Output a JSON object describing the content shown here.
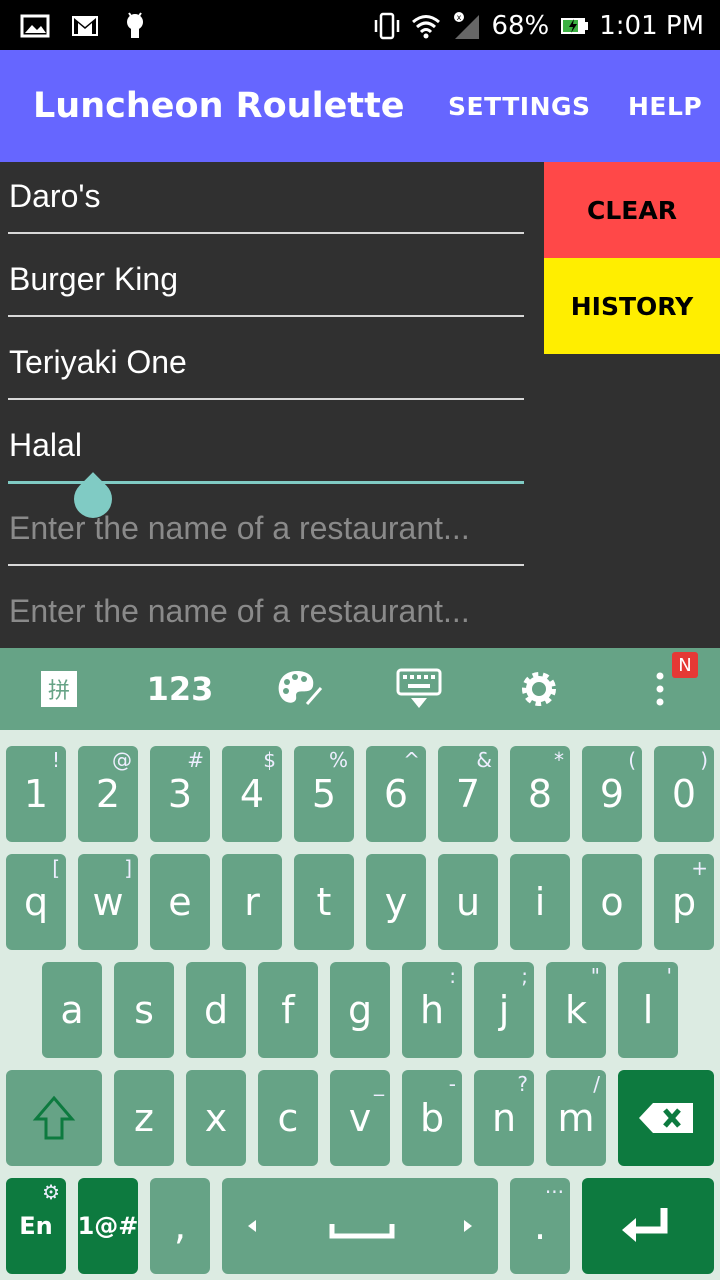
{
  "status_bar": {
    "battery": "68%",
    "time": "1:01 PM"
  },
  "app_bar": {
    "title": "Luncheon Roulette",
    "settings_label": "SETTINGS",
    "help_label": "HELP"
  },
  "restaurants": [
    {
      "name": "Daro's"
    },
    {
      "name": "Burger King"
    },
    {
      "name": "Teriyaki One"
    },
    {
      "name": "Halal"
    }
  ],
  "input_placeholder": "Enter the name of a restaurant...",
  "buttons": {
    "clear": "CLEAR",
    "history": "HISTORY"
  },
  "keyboard": {
    "toolbar_numbers_label": "123",
    "toolbar_badge": "N",
    "number_row": [
      "1",
      "2",
      "3",
      "4",
      "5",
      "6",
      "7",
      "8",
      "9",
      "0"
    ],
    "number_row_sup": [
      "!",
      "@",
      "#",
      "$",
      "%",
      "^",
      "&",
      "*",
      "(",
      ")"
    ],
    "row1": [
      "q",
      "w",
      "e",
      "r",
      "t",
      "y",
      "u",
      "i",
      "o",
      "p"
    ],
    "row1_sup": [
      "[",
      "]",
      "",
      "",
      "",
      "",
      "",
      "",
      "",
      "+"
    ],
    "row2": [
      "a",
      "s",
      "d",
      "f",
      "g",
      "h",
      "j",
      "k",
      "l"
    ],
    "row2_sup": [
      "",
      "",
      "",
      "",
      "",
      ":",
      ";",
      "\"",
      "'"
    ],
    "row3": [
      "z",
      "x",
      "c",
      "v",
      "b",
      "n",
      "m"
    ],
    "row3_sup": [
      "",
      "",
      "",
      "_",
      "-",
      "?",
      "/"
    ],
    "lang_label": "En",
    "symbols_label": "1@#",
    "comma": ",",
    "period": "."
  },
  "colors": {
    "app_bar": "#6666ff",
    "clear_button": "#ff4848",
    "history_button": "#ffee00",
    "keyboard_key": "#66a386",
    "keyboard_dark_key": "#0d7a3f",
    "accent": "#80cbc4"
  }
}
